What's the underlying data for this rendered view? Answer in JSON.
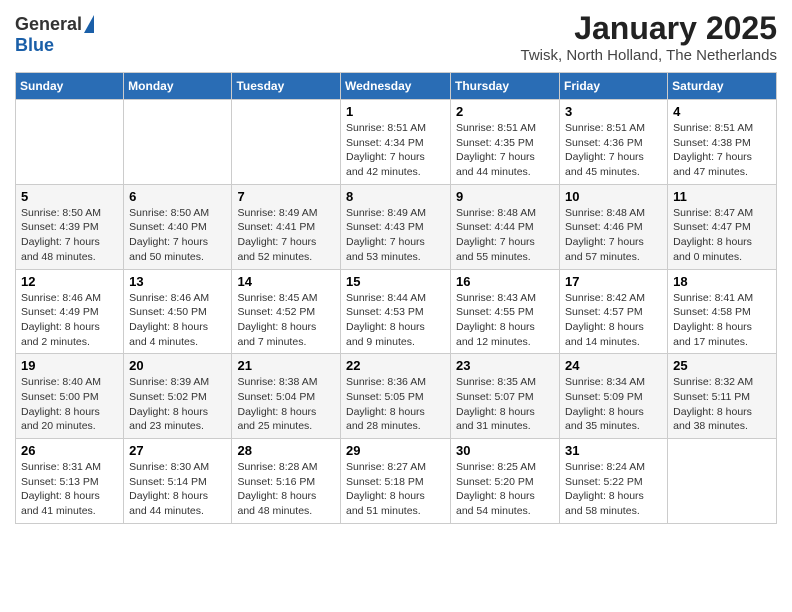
{
  "header": {
    "logo_general": "General",
    "logo_blue": "Blue",
    "month_title": "January 2025",
    "location": "Twisk, North Holland, The Netherlands"
  },
  "days_of_week": [
    "Sunday",
    "Monday",
    "Tuesday",
    "Wednesday",
    "Thursday",
    "Friday",
    "Saturday"
  ],
  "weeks": [
    [
      {
        "day": "",
        "sunrise": "",
        "sunset": "",
        "daylight": ""
      },
      {
        "day": "",
        "sunrise": "",
        "sunset": "",
        "daylight": ""
      },
      {
        "day": "",
        "sunrise": "",
        "sunset": "",
        "daylight": ""
      },
      {
        "day": "1",
        "sunrise": "Sunrise: 8:51 AM",
        "sunset": "Sunset: 4:34 PM",
        "daylight": "Daylight: 7 hours and 42 minutes."
      },
      {
        "day": "2",
        "sunrise": "Sunrise: 8:51 AM",
        "sunset": "Sunset: 4:35 PM",
        "daylight": "Daylight: 7 hours and 44 minutes."
      },
      {
        "day": "3",
        "sunrise": "Sunrise: 8:51 AM",
        "sunset": "Sunset: 4:36 PM",
        "daylight": "Daylight: 7 hours and 45 minutes."
      },
      {
        "day": "4",
        "sunrise": "Sunrise: 8:51 AM",
        "sunset": "Sunset: 4:38 PM",
        "daylight": "Daylight: 7 hours and 47 minutes."
      }
    ],
    [
      {
        "day": "5",
        "sunrise": "Sunrise: 8:50 AM",
        "sunset": "Sunset: 4:39 PM",
        "daylight": "Daylight: 7 hours and 48 minutes."
      },
      {
        "day": "6",
        "sunrise": "Sunrise: 8:50 AM",
        "sunset": "Sunset: 4:40 PM",
        "daylight": "Daylight: 7 hours and 50 minutes."
      },
      {
        "day": "7",
        "sunrise": "Sunrise: 8:49 AM",
        "sunset": "Sunset: 4:41 PM",
        "daylight": "Daylight: 7 hours and 52 minutes."
      },
      {
        "day": "8",
        "sunrise": "Sunrise: 8:49 AM",
        "sunset": "Sunset: 4:43 PM",
        "daylight": "Daylight: 7 hours and 53 minutes."
      },
      {
        "day": "9",
        "sunrise": "Sunrise: 8:48 AM",
        "sunset": "Sunset: 4:44 PM",
        "daylight": "Daylight: 7 hours and 55 minutes."
      },
      {
        "day": "10",
        "sunrise": "Sunrise: 8:48 AM",
        "sunset": "Sunset: 4:46 PM",
        "daylight": "Daylight: 7 hours and 57 minutes."
      },
      {
        "day": "11",
        "sunrise": "Sunrise: 8:47 AM",
        "sunset": "Sunset: 4:47 PM",
        "daylight": "Daylight: 8 hours and 0 minutes."
      }
    ],
    [
      {
        "day": "12",
        "sunrise": "Sunrise: 8:46 AM",
        "sunset": "Sunset: 4:49 PM",
        "daylight": "Daylight: 8 hours and 2 minutes."
      },
      {
        "day": "13",
        "sunrise": "Sunrise: 8:46 AM",
        "sunset": "Sunset: 4:50 PM",
        "daylight": "Daylight: 8 hours and 4 minutes."
      },
      {
        "day": "14",
        "sunrise": "Sunrise: 8:45 AM",
        "sunset": "Sunset: 4:52 PM",
        "daylight": "Daylight: 8 hours and 7 minutes."
      },
      {
        "day": "15",
        "sunrise": "Sunrise: 8:44 AM",
        "sunset": "Sunset: 4:53 PM",
        "daylight": "Daylight: 8 hours and 9 minutes."
      },
      {
        "day": "16",
        "sunrise": "Sunrise: 8:43 AM",
        "sunset": "Sunset: 4:55 PM",
        "daylight": "Daylight: 8 hours and 12 minutes."
      },
      {
        "day": "17",
        "sunrise": "Sunrise: 8:42 AM",
        "sunset": "Sunset: 4:57 PM",
        "daylight": "Daylight: 8 hours and 14 minutes."
      },
      {
        "day": "18",
        "sunrise": "Sunrise: 8:41 AM",
        "sunset": "Sunset: 4:58 PM",
        "daylight": "Daylight: 8 hours and 17 minutes."
      }
    ],
    [
      {
        "day": "19",
        "sunrise": "Sunrise: 8:40 AM",
        "sunset": "Sunset: 5:00 PM",
        "daylight": "Daylight: 8 hours and 20 minutes."
      },
      {
        "day": "20",
        "sunrise": "Sunrise: 8:39 AM",
        "sunset": "Sunset: 5:02 PM",
        "daylight": "Daylight: 8 hours and 23 minutes."
      },
      {
        "day": "21",
        "sunrise": "Sunrise: 8:38 AM",
        "sunset": "Sunset: 5:04 PM",
        "daylight": "Daylight: 8 hours and 25 minutes."
      },
      {
        "day": "22",
        "sunrise": "Sunrise: 8:36 AM",
        "sunset": "Sunset: 5:05 PM",
        "daylight": "Daylight: 8 hours and 28 minutes."
      },
      {
        "day": "23",
        "sunrise": "Sunrise: 8:35 AM",
        "sunset": "Sunset: 5:07 PM",
        "daylight": "Daylight: 8 hours and 31 minutes."
      },
      {
        "day": "24",
        "sunrise": "Sunrise: 8:34 AM",
        "sunset": "Sunset: 5:09 PM",
        "daylight": "Daylight: 8 hours and 35 minutes."
      },
      {
        "day": "25",
        "sunrise": "Sunrise: 8:32 AM",
        "sunset": "Sunset: 5:11 PM",
        "daylight": "Daylight: 8 hours and 38 minutes."
      }
    ],
    [
      {
        "day": "26",
        "sunrise": "Sunrise: 8:31 AM",
        "sunset": "Sunset: 5:13 PM",
        "daylight": "Daylight: 8 hours and 41 minutes."
      },
      {
        "day": "27",
        "sunrise": "Sunrise: 8:30 AM",
        "sunset": "Sunset: 5:14 PM",
        "daylight": "Daylight: 8 hours and 44 minutes."
      },
      {
        "day": "28",
        "sunrise": "Sunrise: 8:28 AM",
        "sunset": "Sunset: 5:16 PM",
        "daylight": "Daylight: 8 hours and 48 minutes."
      },
      {
        "day": "29",
        "sunrise": "Sunrise: 8:27 AM",
        "sunset": "Sunset: 5:18 PM",
        "daylight": "Daylight: 8 hours and 51 minutes."
      },
      {
        "day": "30",
        "sunrise": "Sunrise: 8:25 AM",
        "sunset": "Sunset: 5:20 PM",
        "daylight": "Daylight: 8 hours and 54 minutes."
      },
      {
        "day": "31",
        "sunrise": "Sunrise: 8:24 AM",
        "sunset": "Sunset: 5:22 PM",
        "daylight": "Daylight: 8 hours and 58 minutes."
      },
      {
        "day": "",
        "sunrise": "",
        "sunset": "",
        "daylight": ""
      }
    ]
  ]
}
